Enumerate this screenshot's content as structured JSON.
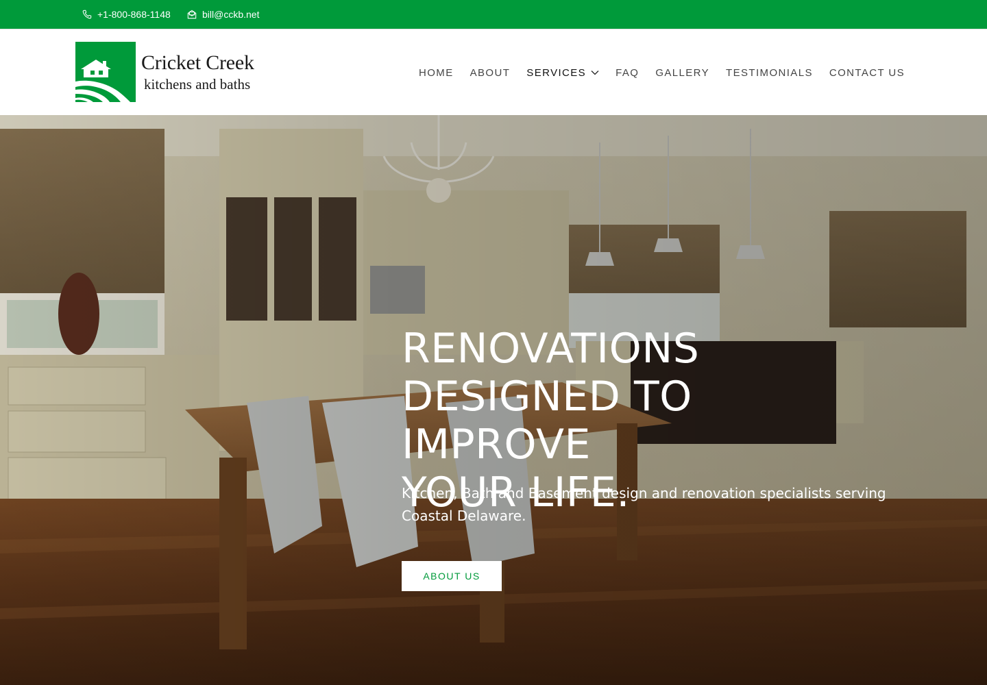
{
  "topbar": {
    "phone": "+1-800-868-1148",
    "email": "bill@cckb.net",
    "phone_icon": "phone-icon",
    "email_icon": "envelope-icon",
    "background": "#009a3a"
  },
  "logo": {
    "title": "Cricket Creek",
    "subtitle": "kitchens and baths",
    "brand_color": "#009a3a"
  },
  "nav": {
    "items": [
      {
        "label": "HOME"
      },
      {
        "label": "ABOUT"
      },
      {
        "label": "SERVICES",
        "has_dropdown": true,
        "active": true
      },
      {
        "label": "FAQ"
      },
      {
        "label": "GALLERY"
      },
      {
        "label": "TESTIMONIALS"
      },
      {
        "label": "CONTACT US"
      }
    ]
  },
  "hero": {
    "title_lines": [
      "RENOVATIONS",
      "DESIGNED TO IMPROVE",
      "YOUR LIFE."
    ],
    "subtitle": "Kitchen, Bath and Basement design and renovation specialists serving Coastal Delaware.",
    "button_label": "ABOUT US"
  }
}
